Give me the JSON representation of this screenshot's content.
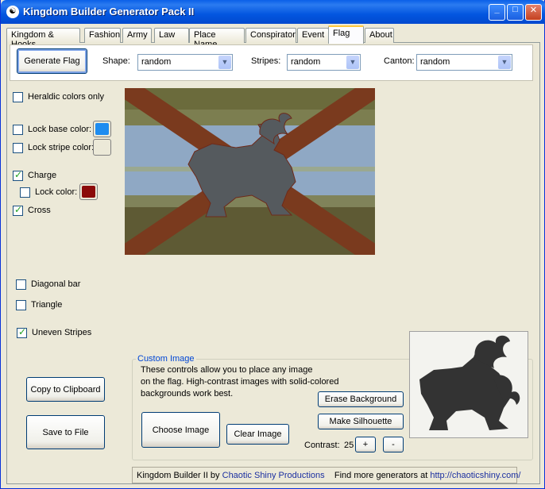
{
  "window": {
    "title": "Kingdom Builder Generator Pack II",
    "app_icon": "yin-yang-icon"
  },
  "title_buttons": {
    "minimize": "_",
    "maximize": "□",
    "close": "✕"
  },
  "tabs": [
    {
      "label": "Kingdom & Hooks"
    },
    {
      "label": "Fashion"
    },
    {
      "label": "Army"
    },
    {
      "label": "Law"
    },
    {
      "label": "Place Name"
    },
    {
      "label": "Conspirator"
    },
    {
      "label": "Event"
    },
    {
      "label": "Flag"
    },
    {
      "label": "About"
    }
  ],
  "active_tab": "Flag",
  "toolbar": {
    "generate_label": "Generate Flag",
    "shape_label": "Shape:",
    "shape_value": "random",
    "stripes_label": "Stripes:",
    "stripes_value": "random",
    "canton_label": "Canton:",
    "canton_value": "random"
  },
  "options": {
    "heraldic": {
      "label": "Heraldic colors only",
      "checked": false
    },
    "lock_base": {
      "label": "Lock base color:",
      "checked": false,
      "color": "#1e8cf0"
    },
    "lock_stripe": {
      "label": "Lock stripe color:",
      "checked": false,
      "color": "#ece9d8"
    },
    "charge": {
      "label": "Charge",
      "checked": true
    },
    "lock_charge": {
      "label": "Lock color:",
      "checked": false,
      "color": "#8b0a0a"
    },
    "cross": {
      "label": "Cross",
      "checked": true
    },
    "diagonal": {
      "label": "Diagonal bar",
      "checked": false
    },
    "triangle": {
      "label": "Triangle",
      "checked": false
    },
    "uneven": {
      "label": "Uneven Stripes",
      "checked": true
    }
  },
  "flag_colors": {
    "top": "#6b6b3c",
    "middle": "#8fa8c4",
    "bottom": "#5e5a34",
    "cross": "#7a3a1e",
    "charge": "#555a5e"
  },
  "actions": {
    "copy_label": "Copy to Clipboard",
    "save_label": "Save to File"
  },
  "custom_image": {
    "title": "Custom Image",
    "description_1": "These controls allow you to place any image",
    "description_2": "on the flag. High-contrast  images with solid-colored",
    "description_3": "backgrounds work best.",
    "choose_label": "Choose Image",
    "clear_label": "Clear Image",
    "erase_label": "Erase Background",
    "silhouette_label": "Make Silhouette",
    "contrast_label": "Contrast:",
    "contrast_value": "25",
    "plus_label": "+",
    "minus_label": "-"
  },
  "status": {
    "prefix": "Kingdom Builder II by",
    "company": "Chaotic Shiny Productions",
    "more": "Find more generators at",
    "url": "http://chaoticshiny.com/"
  }
}
